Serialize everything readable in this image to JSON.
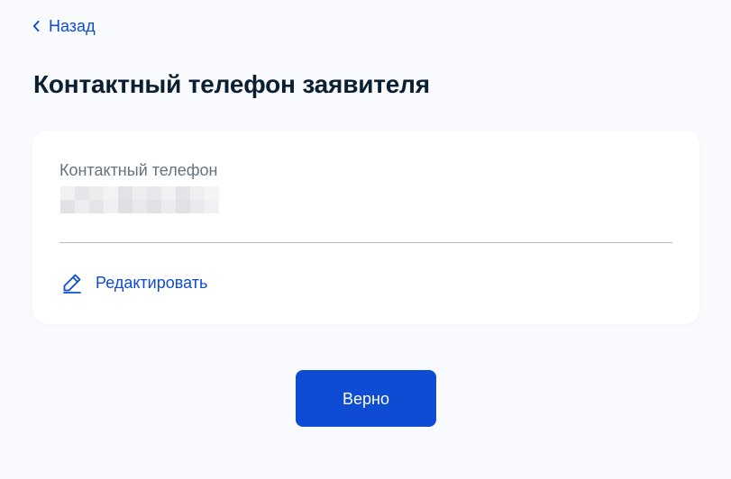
{
  "nav": {
    "back_label": "Назад",
    "back_icon": "chevron-left-icon"
  },
  "page": {
    "title": "Контактный телефон заявителя"
  },
  "card": {
    "field_label": "Контактный телефон",
    "field_value_masked": true,
    "edit_label": "Редактировать",
    "edit_icon": "pencil-icon"
  },
  "actions": {
    "confirm_label": "Верно"
  },
  "colors": {
    "background": "#f9fafd",
    "card": "#ffffff",
    "text_primary": "#0b1f33",
    "text_secondary": "#66727f",
    "link": "#0d4cd3",
    "button_bg": "#0d4cd3",
    "button_text": "#ffffff",
    "divider": "#b0bfd6"
  }
}
